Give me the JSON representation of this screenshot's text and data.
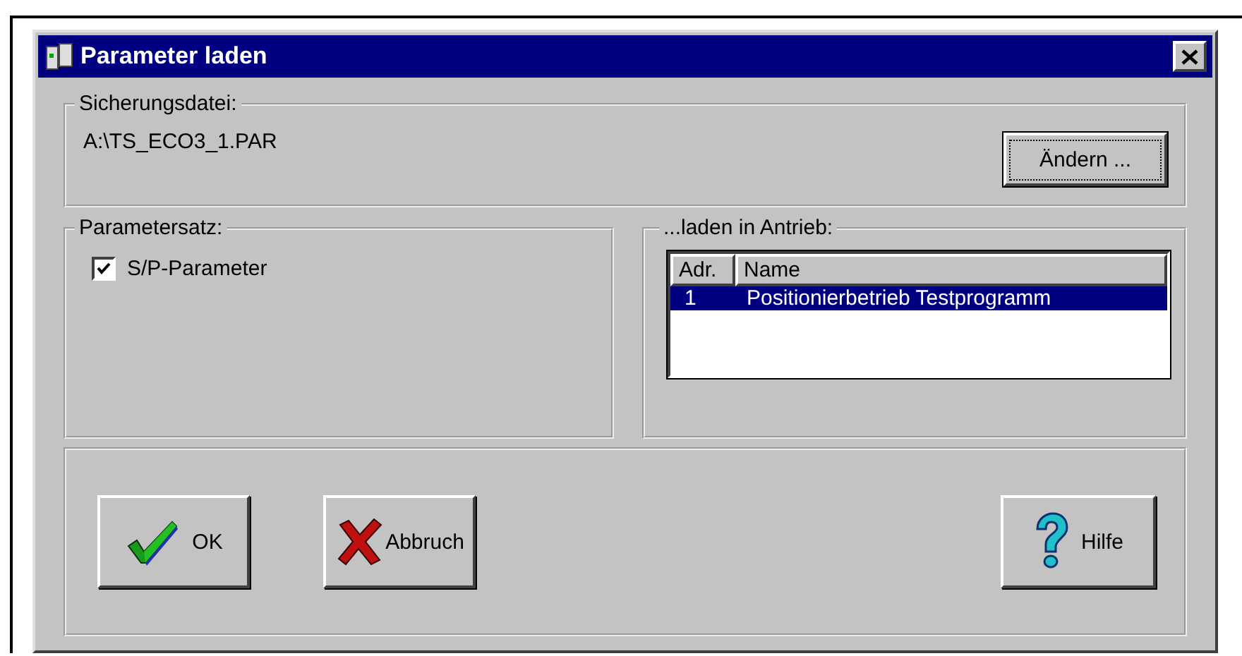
{
  "window": {
    "title": "Parameter laden"
  },
  "backup_file": {
    "legend": "Sicherungsdatei:",
    "path": "A:\\TS_ECO3_1.PAR",
    "change_button": "Ändern ..."
  },
  "parameter_set": {
    "legend": "Parametersatz:",
    "options": [
      {
        "label": "S/P-Parameter",
        "checked": true
      }
    ]
  },
  "target_drive": {
    "legend": "...laden in Antrieb:",
    "columns": [
      "Adr.",
      "Name"
    ],
    "rows": [
      {
        "cells": [
          "1",
          "Positionierbetrieb Testprogramm"
        ],
        "selected": true
      }
    ]
  },
  "buttons": [
    {
      "kind": "ok",
      "label": "OK"
    },
    {
      "kind": "cancel",
      "label": "Abbruch"
    },
    {
      "kind": "help",
      "label": "Hilfe"
    }
  ]
}
